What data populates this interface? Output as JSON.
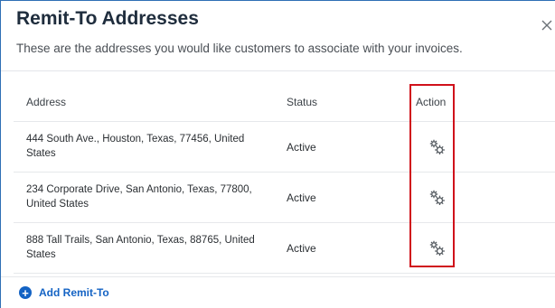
{
  "modal": {
    "title": "Remit-To Addresses",
    "subtitle": "These are the addresses you would like customers to associate with your invoices.",
    "close_icon": "close-icon"
  },
  "table": {
    "columns": {
      "address": "Address",
      "status": "Status",
      "action": "Action"
    },
    "rows": [
      {
        "address": "444 South Ave., Houston, Texas, 77456, United States",
        "status": "Active",
        "action_icon": "gears-icon"
      },
      {
        "address": "234 Corporate Drive, San Antonio, Texas, 77800, United States",
        "status": "Active",
        "action_icon": "gears-icon"
      },
      {
        "address": "888 Tall Trails, San Antonio, Texas, 88765, United States",
        "status": "Active",
        "action_icon": "gears-icon"
      }
    ]
  },
  "footer": {
    "add_label": "Add Remit-To",
    "add_icon": "plus-circle-icon"
  },
  "colors": {
    "accent": "#1463c4",
    "highlight": "#d0111b",
    "title": "#1f2d3d"
  }
}
